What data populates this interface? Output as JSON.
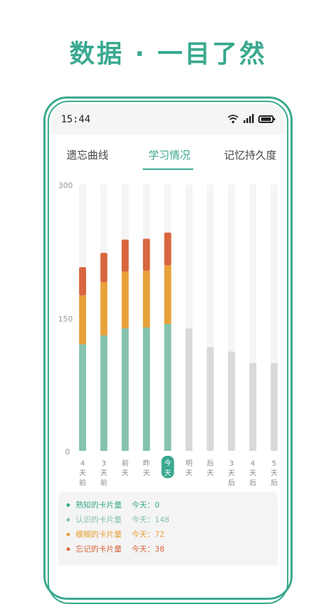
{
  "headline": "数据 · 一目了然",
  "status": {
    "time": "15:44"
  },
  "tabs": [
    {
      "label": "遗忘曲线"
    },
    {
      "label": "学习情况"
    },
    {
      "label": "记忆持久度"
    }
  ],
  "colors": {
    "accent": "#3aa98f",
    "known": "#85c3ad",
    "fuzzy": "#e8a13a",
    "forgot": "#d9663f",
    "future": "#d9d9d9",
    "track": "#f5f5f5"
  },
  "chart_data": {
    "type": "bar",
    "stacked": true,
    "ylim": [
      0,
      300
    ],
    "yticks": [
      "300",
      "150",
      "0"
    ],
    "categories": [
      [
        "4",
        "天",
        "前"
      ],
      [
        "3",
        "天",
        "前"
      ],
      [
        "前",
        "天"
      ],
      [
        "昨",
        "天"
      ],
      [
        "今",
        "天"
      ],
      [
        "明",
        "天"
      ],
      [
        "后",
        "天"
      ],
      [
        "3",
        "天",
        "后"
      ],
      [
        "4",
        "天",
        "后"
      ],
      [
        "5",
        "天",
        "后"
      ]
    ],
    "highlight_index": 4,
    "series": [
      {
        "name": "认识的卡片量",
        "values": [
          120,
          130,
          138,
          139,
          143,
          0,
          0,
          0,
          0,
          0
        ]
      },
      {
        "name": "模糊的卡片量",
        "values": [
          55,
          60,
          64,
          64,
          66,
          0,
          0,
          0,
          0,
          0
        ]
      },
      {
        "name": "忘记的卡片量",
        "values": [
          32,
          33,
          36,
          36,
          37,
          0,
          0,
          0,
          0,
          0
        ]
      }
    ],
    "future_values": [
      0,
      0,
      0,
      0,
      0,
      138,
      117,
      112,
      99,
      99
    ]
  },
  "legend": [
    {
      "label": "熟知的卡片量",
      "today": "今天：0",
      "color": "#3aa98f"
    },
    {
      "label": "认识的卡片量",
      "today": "今天：148",
      "color": "#85c3ad"
    },
    {
      "label": "模糊的卡片量",
      "today": "今天：72",
      "color": "#e8a13a"
    },
    {
      "label": "忘记的卡片量",
      "today": "今天：38",
      "color": "#d9663f"
    }
  ]
}
